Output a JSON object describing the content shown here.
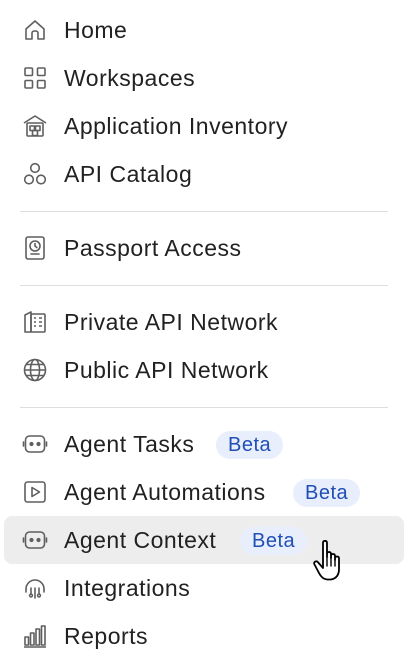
{
  "menu": {
    "items": [
      {
        "label": "Home",
        "icon": "home-icon"
      },
      {
        "label": "Workspaces",
        "icon": "grid-icon"
      },
      {
        "label": "Application Inventory",
        "icon": "inventory-icon"
      },
      {
        "label": "API Catalog",
        "icon": "catalog-icon"
      },
      {
        "label": "Passport Access",
        "icon": "passport-icon"
      },
      {
        "label": "Private API Network",
        "icon": "private-network-icon"
      },
      {
        "label": "Public API Network",
        "icon": "globe-icon"
      },
      {
        "label": "Agent Tasks",
        "icon": "robot-icon",
        "badge": "Beta"
      },
      {
        "label": "Agent Automations",
        "icon": "play-icon",
        "badge": "Beta"
      },
      {
        "label": "Agent Context",
        "icon": "robot-icon",
        "badge": "Beta"
      },
      {
        "label": "Integrations",
        "icon": "integrations-icon"
      },
      {
        "label": "Reports",
        "icon": "bar-chart-icon"
      }
    ],
    "hovered_item": "Agent Context"
  },
  "colors": {
    "text": "#212121",
    "icon": "#5f5f5f",
    "hover_background": "#ededed",
    "badge_background": "#e8eefc",
    "badge_text": "#1f4fb5",
    "divider": "#dedede"
  }
}
